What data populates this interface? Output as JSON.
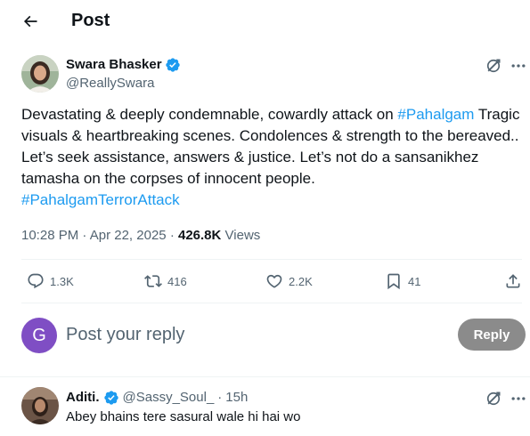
{
  "header": {
    "title": "Post",
    "back_icon": "arrow-left-icon"
  },
  "post": {
    "author": {
      "name": "Swara Bhasker",
      "handle": "@ReallySwara",
      "verified": true,
      "verified_color": "#1d9bf0"
    },
    "text": {
      "part1": "Devastating & deeply condemnable, cowardly attack on ",
      "hashtag1": "#Pahalgam",
      "part2": " Tragic visuals & heartbreaking scenes. Condolences & strength to the bereaved.. Let’s seek assistance, answers & justice. Let’s not do a sansanikhez tamasha on the corpses of innocent people.",
      "hashtag2": "#PahalgamTerrorAttack"
    },
    "meta": {
      "time": "10:28 PM",
      "separator": "·",
      "date": "Apr 22, 2025",
      "views_count": "426.8K",
      "views_label": "Views"
    },
    "actions": {
      "replies": "1.3K",
      "reposts": "416",
      "likes": "2.2K",
      "bookmarks": "41"
    }
  },
  "composer": {
    "avatar_letter": "G",
    "avatar_color": "#7f4ec4",
    "placeholder": "Post your reply",
    "reply_button": "Reply"
  },
  "replies": [
    {
      "name": "Aditi.",
      "verified": true,
      "handle": "@Sassy_Soul_",
      "separator": "·",
      "time": "15h",
      "text": "Abey bhains tere sasural wale hi hai wo"
    }
  ],
  "colors": {
    "accent": "#1d9bf0",
    "text": "#0f1419",
    "muted": "#536471",
    "divider": "#eff3f4",
    "reply_button_bg": "#8b8b8b"
  }
}
